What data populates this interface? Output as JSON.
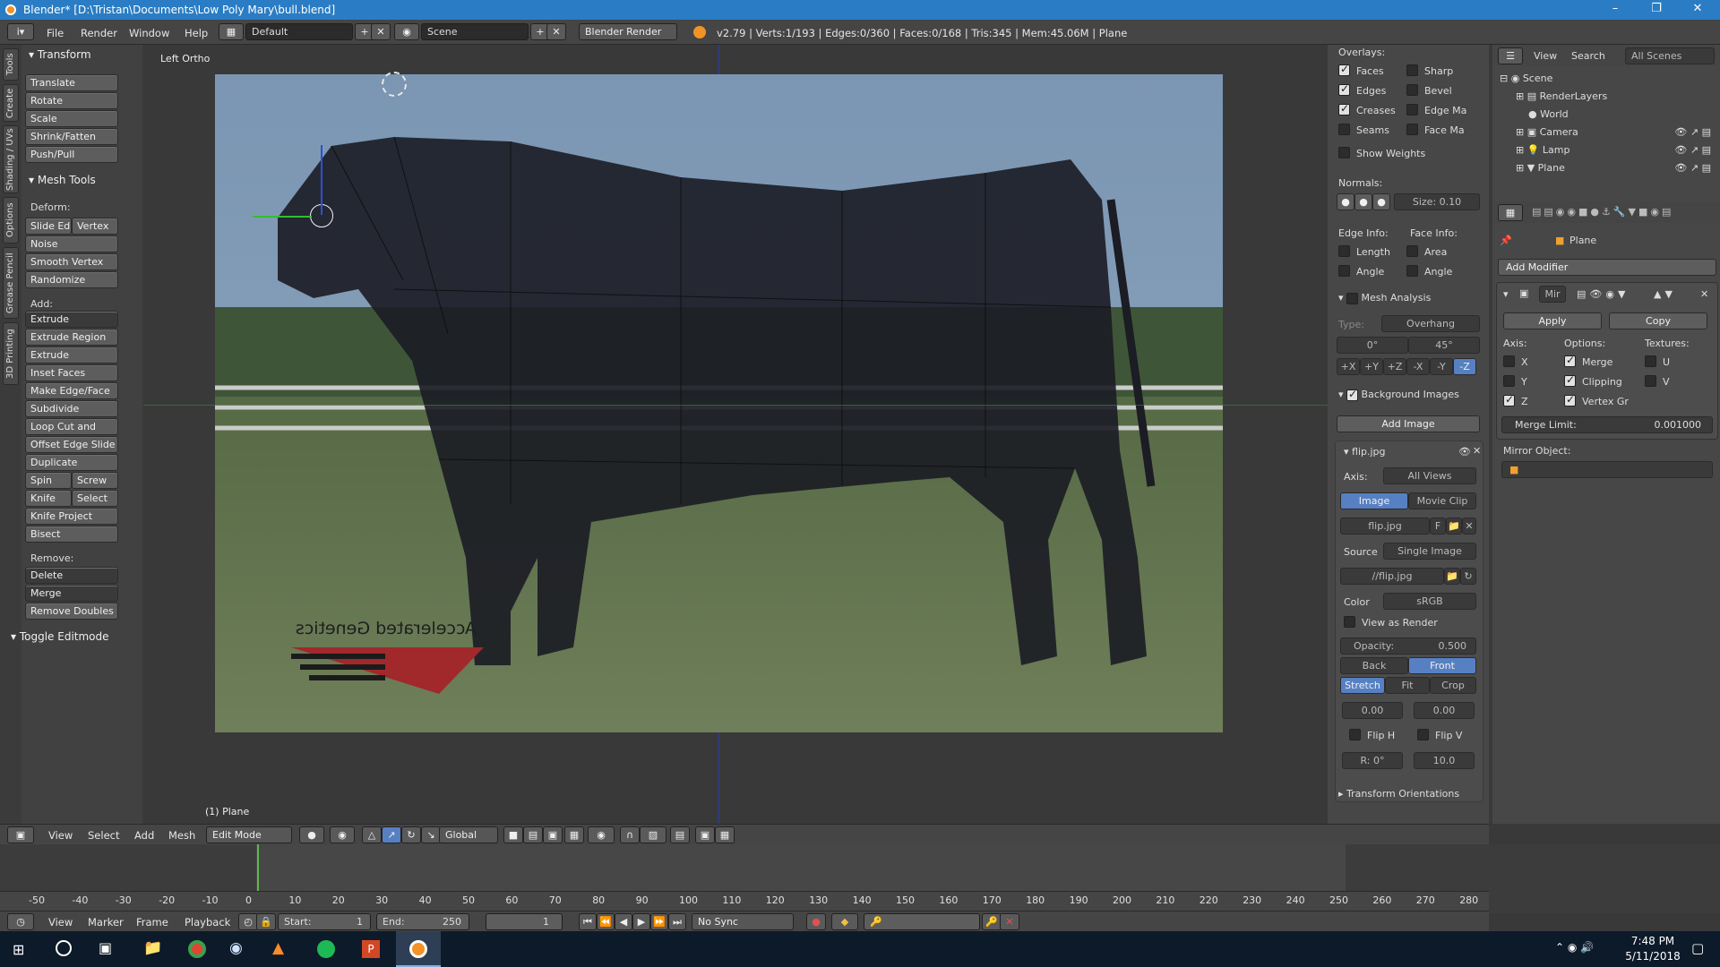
{
  "window": {
    "title": "Blender* [D:\\Tristan\\Documents\\Low Poly Mary\\bull.blend]"
  },
  "info_header": {
    "menus": [
      "File",
      "Render",
      "Window",
      "Help"
    ],
    "screen_layout": "Default",
    "scene": "Scene",
    "render_engine": "Blender Render",
    "stats": "v2.79 | Verts:1/193 | Edges:0/360 | Faces:0/168 | Tris:345 | Mem:45.06M | Plane"
  },
  "side_tabs": [
    "Tools",
    "Create",
    "Shading / UVs",
    "Options",
    "Grease Pencil",
    "3D Printing"
  ],
  "toolshelf": {
    "transform_header": "Transform",
    "transform_buttons": [
      "Translate",
      "Rotate",
      "Scale",
      "Shrink/Fatten",
      "Push/Pull"
    ],
    "mesh_tools_header": "Mesh Tools",
    "deform_label": "Deform:",
    "deform_row": [
      "Slide Ed",
      "Vertex"
    ],
    "deform_buttons": [
      "Noise",
      "Smooth Vertex",
      "Randomize"
    ],
    "add_label": "Add:",
    "extrude": "Extrude",
    "add_buttons": [
      "Extrude Region",
      "Extrude Individual",
      "Inset Faces",
      "Make Edge/Face",
      "Subdivide",
      "Loop Cut and Slide",
      "Offset Edge Slide",
      "Duplicate"
    ],
    "spin_row": [
      "Spin",
      "Screw"
    ],
    "knife_row": [
      "Knife",
      "Select"
    ],
    "more_buttons": [
      "Knife Project",
      "Bisect"
    ],
    "remove_label": "Remove:",
    "delete": "Delete",
    "merge": "Merge",
    "remove_doubles": "Remove Doubles",
    "toggle_header": "Toggle Editmode"
  },
  "viewport": {
    "view_label": "Left Ortho",
    "object_label": "(1) Plane",
    "bg_logo_text": "Accelerated Genetics"
  },
  "npanel": {
    "overlays_label": "Overlays:",
    "overlays_left": [
      {
        "label": "Faces",
        "on": true
      },
      {
        "label": "Edges",
        "on": true
      },
      {
        "label": "Creases",
        "on": true
      },
      {
        "label": "Seams",
        "on": false
      }
    ],
    "overlays_right": [
      {
        "label": "Sharp",
        "on": false
      },
      {
        "label": "Bevel",
        "on": false
      },
      {
        "label": "Edge Ma",
        "on": false
      },
      {
        "label": "Face Ma",
        "on": false
      }
    ],
    "show_weights": "Show Weights",
    "normals_label": "Normals:",
    "normals_size": "Size:  0.10",
    "edge_info": "Edge Info:",
    "face_info": "Face Info:",
    "length": "Length",
    "area": "Area",
    "angle": "Angle",
    "angle2": "Angle",
    "mesh_analysis": "Mesh Analysis",
    "type_label": "Type:",
    "type_value": "Overhang",
    "deg0": "0°",
    "deg45": "45°",
    "axes": [
      "+X",
      "+Y",
      "+Z",
      "-X",
      "-Y",
      "-Z"
    ],
    "bg_images": "Background Images",
    "add_image": "Add Image",
    "image_name": "flip.jpg",
    "axis_label": "Axis:",
    "axis_value": "All Views",
    "image_tab": "Image",
    "movieclip_tab": "Movie Clip",
    "image_field": "flip.jpg",
    "image_f": "F",
    "source_label": "Source",
    "source_value": "Single Image",
    "filepath": "//flip.jpg",
    "color_label": "Color",
    "color_value": "sRGB",
    "view_as_render": "View as Render",
    "opacity_label": "Opacity:",
    "opacity_value": "0.500",
    "back": "Back",
    "front": "Front",
    "stretch": "Stretch",
    "fit": "Fit",
    "crop": "Crop",
    "offset_x": "0.00",
    "offset_y": "0.00",
    "flip_h": "Flip H",
    "flip_v": "Flip V",
    "rotation": "R: 0°",
    "size": "10.0",
    "transform_orientations": "Transform Orientations"
  },
  "outliner": {
    "view": "View",
    "search": "Search",
    "filter": "All Scenes",
    "items": [
      "Scene",
      "RenderLayers",
      "World",
      "Camera",
      "Lamp",
      "Plane"
    ]
  },
  "properties": {
    "object_name": "Plane",
    "add_modifier": "Add Modifier",
    "modifier_name": "Mir",
    "apply": "Apply",
    "copy": "Copy",
    "axis_label": "Axis:",
    "options_label": "Options:",
    "textures_label": "Textures:",
    "axis_items": [
      {
        "label": "X",
        "on": false
      },
      {
        "label": "Y",
        "on": false
      },
      {
        "label": "Z",
        "on": true
      }
    ],
    "option_items": [
      {
        "label": "Merge",
        "on": true
      },
      {
        "label": "Clipping",
        "on": true
      },
      {
        "label": "Vertex Gr",
        "on": true
      }
    ],
    "texture_items": [
      {
        "label": "U",
        "on": false
      },
      {
        "label": "V",
        "on": false
      }
    ],
    "merge_limit_label": "Merge Limit:",
    "merge_limit_value": "0.001000",
    "mirror_object": "Mirror Object:"
  },
  "view3d_header": {
    "menus": [
      "View",
      "Select",
      "Add",
      "Mesh"
    ],
    "mode": "Edit Mode",
    "orientation": "Global"
  },
  "timeline": {
    "ticks": [
      -50,
      -40,
      -30,
      -20,
      -10,
      0,
      10,
      20,
      30,
      40,
      50,
      60,
      70,
      80,
      90,
      100,
      110,
      120,
      130,
      140,
      150,
      160,
      170,
      180,
      190,
      200,
      210,
      220,
      230,
      240,
      250,
      260,
      270,
      280
    ],
    "menus": [
      "View",
      "Marker",
      "Frame",
      "Playback"
    ],
    "start": "Start:",
    "start_value": "1",
    "end": "End:",
    "end_value": "250",
    "current": "1",
    "sync": "No Sync"
  },
  "taskbar": {
    "time": "7:48 PM",
    "date": "5/11/2018"
  }
}
